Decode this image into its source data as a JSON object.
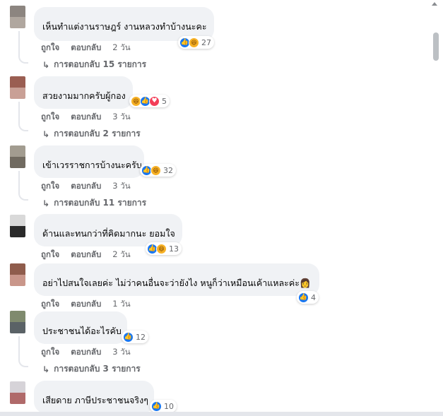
{
  "actions": {
    "like": "ถูกใจ",
    "reply": "ตอบกลับ"
  },
  "comments": [
    {
      "name": "",
      "text": "เห็นทำแต่งานราษฎร์ งานหลวงทำบ้างนะคะ",
      "reaction_count": "27",
      "time": "2 วัน",
      "replies": "การตอบกลับ 15 รายการ",
      "avatar_colors": [
        "#8c8580",
        "#b0a79f"
      ]
    },
    {
      "name": "",
      "text": "สวยงามมากครับผู้กอง",
      "reaction_count": "5",
      "time": "3 วัน",
      "replies": "การตอบกลับ 2 รายการ",
      "avatar_colors": [
        "#9a5e52",
        "#c9a096"
      ]
    },
    {
      "name": "",
      "text": "เข้าเวรราชการบ้างนะครับ",
      "reaction_count": "32",
      "time": "3 วัน",
      "replies": "การตอบกลับ 11 รายการ",
      "avatar_colors": [
        "#a29c90",
        "#706a60"
      ]
    },
    {
      "name": "",
      "text": "ด้านและทนกว่าที่คิดมากนะ ยอมใจ",
      "reaction_count": "13",
      "time": "2 วัน",
      "replies": "",
      "avatar_colors": [
        "#d9d9d9",
        "#2a2a2a"
      ]
    },
    {
      "name": "",
      "text": "อย่าไปสนใจเลยค่ะ ไม่ว่าคนอื่นจะว่ายังไง หนูก็ว่าเหมือนเค้าแหละค่ะ👩",
      "reaction_count": "4",
      "time": "1 วัน",
      "replies": "",
      "avatar_colors": [
        "#8f5c4c",
        "#c9968a"
      ]
    },
    {
      "name": "",
      "text": "ประชาชนได้อะไรคับ",
      "reaction_count": "12",
      "time": "3 วัน",
      "replies": "การตอบกลับ 3 รายการ",
      "avatar_colors": [
        "#7f8a6e",
        "#5a6266"
      ]
    },
    {
      "name": "",
      "text": "เสียดาย ภาษีประชาชนจริงๆ",
      "reaction_count": "10",
      "time": "",
      "replies": "",
      "avatar_colors": [
        "#d6d3d8",
        "#b06a6a"
      ]
    }
  ],
  "colors": {
    "like_blue": "#1877f2",
    "bubble_bg": "#f0f2f5",
    "meta_gray": "#65676b"
  },
  "icons": {
    "like": "like-icon",
    "haha": "haha-icon",
    "love": "love-icon",
    "reply_arrow": "reply-arrow-icon"
  }
}
